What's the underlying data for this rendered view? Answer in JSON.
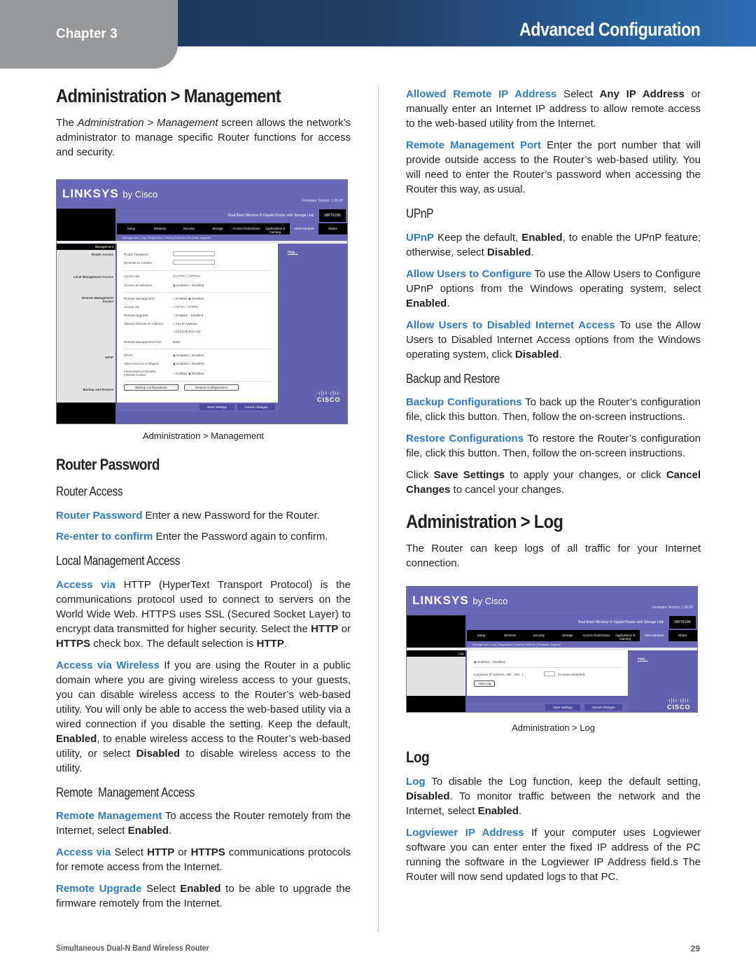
{
  "header": {
    "chapter": "Chapter 3",
    "title": "Advanced Configuration"
  },
  "left": {
    "section_title": "Administration > Management",
    "intro": {
      "pre": "The ",
      "italic": "Administration > Management",
      "post": " screen allows the network’s administrator to manage specific Router functions for access and security."
    },
    "figure": {
      "caption": "Administration > Management",
      "logo": "LINKSYS",
      "logo_suffix": "by Cisco",
      "firmware": "Firmware Version: 1.00.00",
      "product": "Dual Band Wireless N Gigabit Router with Storage Link",
      "model": "WRT610N",
      "page_label": "Administration",
      "tabs": [
        "Setup",
        "Wireless",
        "Security",
        "Storage",
        "Access Restrictions",
        "Applications & Gaming",
        "Administration",
        "Status"
      ],
      "active_tab": "Administration",
      "subtabs": "Management  |  Log  |  Diagnostics  |  Factory Defaults  |  Firmware Upgrade",
      "nav_header": "Management",
      "nav_items": [
        "Router Access",
        "Local Management Access",
        "Remote Management Access",
        "UPnP",
        "Backup and Restore"
      ],
      "rows": [
        {
          "label": "Router Password",
          "value": "******"
        },
        {
          "label": "Re-Enter to Confirm",
          "value": "******"
        },
        {
          "label": "Access via:",
          "value": "☑ HTTP   ☐ HTTPS"
        },
        {
          "label": "Access via Wireless:",
          "value": "◉ Enabled  ○ Disabled"
        },
        {
          "label": "Remote Management:",
          "value": "○ Enabled  ◉ Disabled"
        },
        {
          "label": "Access via:",
          "value": "○ HTTP   ○ HTTPS"
        },
        {
          "label": "Remote Upgrade:",
          "value": "○ Enabled  ○ Disabled"
        },
        {
          "label": "Allowed Remote IP Address:",
          "value": "○ Any IP Address"
        },
        {
          "label": "",
          "value": "○ [0].[0].[0].[0] to [0]"
        },
        {
          "label": "Remote Management Port:",
          "value": "8080"
        },
        {
          "label": "UPnP:",
          "value": "◉ Enabled  ○ Disabled"
        },
        {
          "label": "Allow Users to Configure:",
          "value": "◉ Enabled  ○ Disabled"
        },
        {
          "label": "Allow Users to Disable Internet Access:",
          "value": "○ Enabled  ◉ Disabled"
        }
      ],
      "backup_button": "Backup Configurations",
      "restore_button": "Restore Configurations",
      "help_link": "Help...",
      "save_button": "Save Settings",
      "cancel_button": "Cancel Changes",
      "cisco_bars": "·ı|ıı·ı|ıı·",
      "cisco_word": "CISCO"
    },
    "router_password": {
      "title": "Router Password",
      "subtitle": "Router Access",
      "items": [
        {
          "term": "Router Password",
          "text": "  Enter a new Password for the Router."
        },
        {
          "term": "Re-enter to confirm",
          "text": "  Enter the Password again to confirm."
        }
      ]
    },
    "local_management": {
      "title": "Local Management Access",
      "access_via": {
        "term": "Access via",
        "t1": " HTTP (HyperText Transport Protocol) is the communications protocol used to connect to servers on the World Wide Web. HTTPS uses SSL (Secured Socket Layer) to encrypt data transmitted for higher security. Select the ",
        "b1": "HTTP",
        "t2": " or ",
        "b2": "HTTPS",
        "t3": " check box. The default selection is ",
        "b3": "HTTP",
        "t4": "."
      },
      "access_wireless": {
        "term": "Access via Wireless",
        "t1": "  If you are using the Router in a public domain where you are giving wireless access to your guests, you can disable wireless access to the Router’s web-based utility. You will only be able to access the web-based utility via a wired connection if you disable the setting. Keep the default, ",
        "b1": "Enabled",
        "t2": ", to enable wireless access to the Router’s web-based utility, or select ",
        "b2": "Disabled",
        "t3": " to disable wireless access to the utility."
      }
    },
    "remote_management": {
      "title": "Remote  Management Access",
      "remote": {
        "term": "Remote Management",
        "t1": " To access the Router remotely from the Internet, select ",
        "b1": "Enabled",
        "t2": "."
      },
      "access_via": {
        "term": "Access via",
        "t1": " Select ",
        "b1": "HTTP",
        "t2": " or ",
        "b2": "HTTPS",
        "t3": " communications protocols for remote access from the Internet."
      },
      "upgrade": {
        "term": "Remote Upgrade",
        "t1": "  Select ",
        "b1": "Enabled",
        "t2": " to be able to upgrade the firmware remotely from the Internet."
      }
    }
  },
  "right": {
    "allowed_ip": {
      "term": "Allowed Remote IP Address",
      "t1": "  Select ",
      "b1": "Any IP Address",
      "t2": " or manually enter an Internet IP address to allow remote access to the web-based utility from the Internet."
    },
    "mgmt_port": {
      "term": "Remote Management Port",
      "t1": "  Enter the port number that will provide outside access to the Router’s web-based utility. You will need to enter the Router’s password when accessing the Router this way, as usual."
    },
    "upnp": {
      "title": "UPnP",
      "upnp": {
        "term": "UPnP",
        "t1": " Keep the default, ",
        "b1": "Enabled",
        "t2": ", to enable the UPnP feature; otherwise, select ",
        "b2": "Disabled",
        "t3": "."
      },
      "configure": {
        "term": "Allow Users to Configure",
        "t1": " To use the Allow Users to Configure UPnP options from the Windows operating system, select ",
        "b1": "Enabled",
        "t2": "."
      },
      "disable": {
        "term": "Allow Users to Disabled Internet Access",
        "t1": " To use the Allow Users to Disabled Internet Access options from the Windows operating system, click ",
        "b1": "Disabled",
        "t2": "."
      }
    },
    "backup": {
      "title": "Backup and Restore",
      "backup": {
        "term": "Backup Configurations",
        "t1": " To back up the Router’s configuration file, click this button. Then, follow the on-screen instructions."
      },
      "restore": {
        "term": "Restore Configurations",
        "t1": " To restore the Router’s configuration file, click this button. Then, follow the on-screen instructions."
      },
      "save": {
        "t1": "Click ",
        "b1": "Save Settings",
        "t2": " to apply your changes, or click ",
        "b2": "Cancel Changes",
        "t3": " to cancel your changes."
      }
    },
    "log_section": {
      "title": "Administration > Log",
      "intro": "The Router can keep logs of all traffic for your Internet connection.",
      "figure": {
        "caption": "Administration > Log",
        "nav_header": "Log",
        "log_radio": "◉ Enabled  ○ Disabled",
        "logviewer_label": "Logviewer IP Address: 192 . 168 . 1 .",
        "logviewer_value": "0",
        "logviewer_hint": "(0 means disabled)",
        "view_log_button": "View Log"
      },
      "log_title": "Log",
      "log": {
        "term": "Log",
        "t1": "  To disable the Log function, keep the default setting, ",
        "b1": "Disabled",
        "t2": ". To monitor traffic between the network and the Internet, select ",
        "b2": "Enabled",
        "t3": "."
      },
      "logviewer": {
        "term": "Logviewer IP Address",
        "t1": "   If your computer uses Logviewer software you can enter enter the fixed IP address of the PC running the software in the Logviewer IP Address field.s The Router will now send updated logs to that PC."
      }
    }
  },
  "footer": {
    "product": "Simultaneous Dual-N Band Wireless Router",
    "page": "29"
  }
}
